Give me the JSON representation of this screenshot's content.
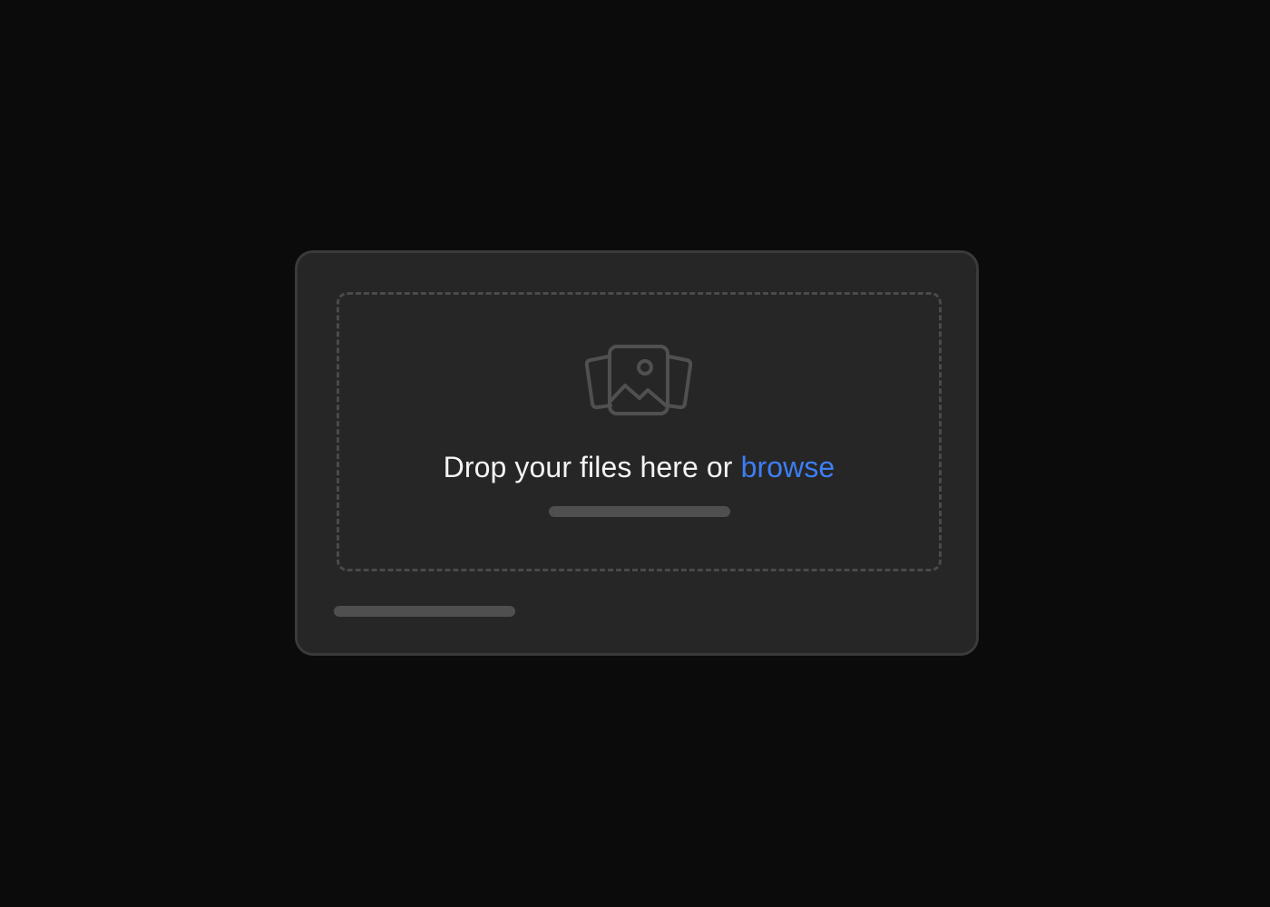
{
  "dropzone": {
    "prompt_text": "Drop your files here or",
    "browse_label": "browse",
    "icon": "images-icon"
  },
  "colors": {
    "background": "#0b0b0c",
    "card": "#262627",
    "accent": "#3d7ef2",
    "text": "#f4f4f5",
    "placeholder_bar": "#4f4f50"
  }
}
